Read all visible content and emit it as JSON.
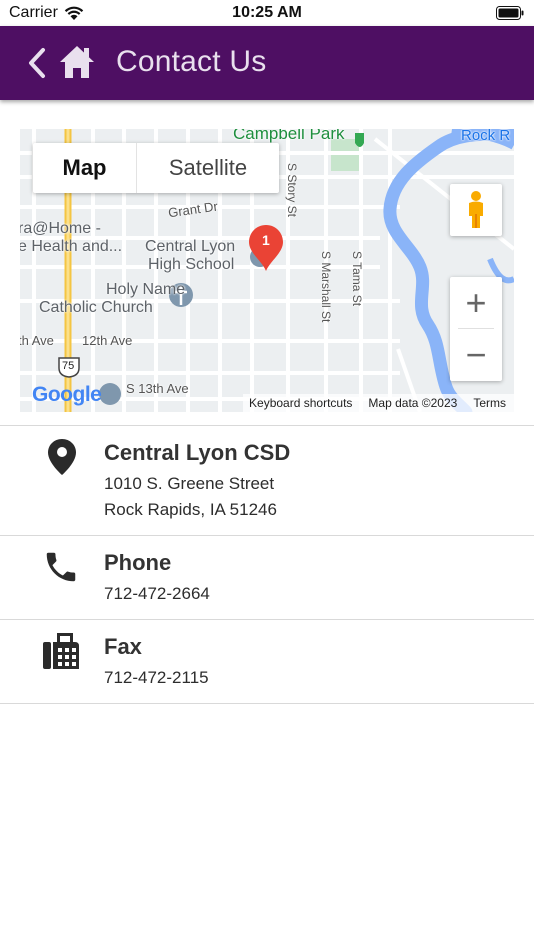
{
  "status_bar": {
    "carrier": "Carrier",
    "time": "10:25 AM"
  },
  "nav": {
    "title": "Contact Us",
    "back_icon": "chevron-left-icon",
    "home_icon": "home-icon"
  },
  "map": {
    "type_buttons": [
      "Map",
      "Satellite"
    ],
    "labels": {
      "campbell_park": "Campbell Park",
      "rock": "Rock R",
      "grant_dr": "Grant Dr",
      "s_story_st": "S Story St",
      "health_1": "ra@Home -",
      "health_2": "e Health and...",
      "central_lyon_1": "Central Lyon",
      "central_lyon_2": "High School",
      "holy_name_1": "Holy Name",
      "holy_name_2": "Catholic Church",
      "s_marshall_st": "S Marshall St",
      "s_tama_st": "S Tama St",
      "th_ave": "th Ave",
      "twelfth_ave": "12th Ave",
      "route": "75",
      "s_13th_ave": "S 13th Ave",
      "marker": "1",
      "google": "Google"
    },
    "footer": [
      "Keyboard shortcuts",
      "Map data ©2023",
      "Terms"
    ],
    "zoom_in": "+",
    "zoom_out": "−"
  },
  "contacts": {
    "address": {
      "title": "Central Lyon CSD",
      "line1": "1010 S. Greene Street",
      "line2": "Rock Rapids, IA  51246",
      "icon": "location-pin-icon"
    },
    "phone": {
      "title": "Phone",
      "value": "712-472-2664",
      "icon": "phone-icon"
    },
    "fax": {
      "title": "Fax",
      "value": "712-472-2115",
      "icon": "fax-icon"
    }
  },
  "colors": {
    "nav_bg": "#4e0f63",
    "nav_text": "#e9e0ee",
    "marker": "#ea4335",
    "river": "#8ab4f8",
    "highway": "#f6c84a"
  }
}
